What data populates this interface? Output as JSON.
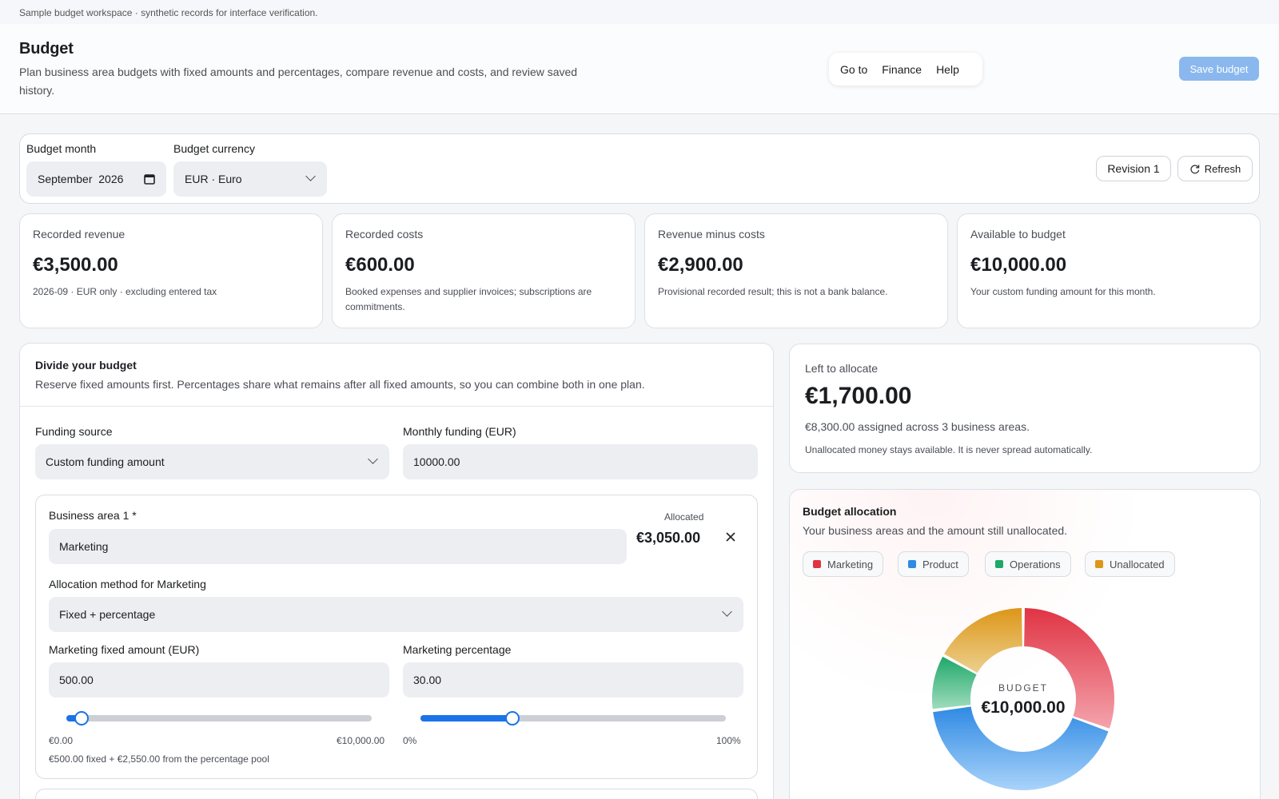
{
  "top_note": "Sample budget workspace · synthetic records for interface verification.",
  "header": {
    "title": "Budget",
    "subtitle": "Plan business area budgets with fixed amounts and percentages, compare revenue and costs, and review saved history.",
    "nav": [
      "Go to",
      "Finance",
      "Help"
    ],
    "save_label": "Save budget"
  },
  "filters": {
    "month_label": "Budget month",
    "month_value": "September  2026",
    "currency_label": "Budget currency",
    "currency_value": "EUR · Euro",
    "revision_label": "Revision 1",
    "refresh_label": "Refresh"
  },
  "stats": [
    {
      "label": "Recorded revenue",
      "value": "€3,500.00",
      "note": "2026-09 · EUR only · excluding entered tax"
    },
    {
      "label": "Recorded costs",
      "value": "€600.00",
      "note": "Booked expenses and supplier invoices; subscriptions are commitments."
    },
    {
      "label": "Revenue minus costs",
      "value": "€2,900.00",
      "note": "Provisional recorded result; this is not a bank balance."
    },
    {
      "label": "Available to budget",
      "value": "€10,000.00",
      "note": "Your custom funding amount for this month."
    }
  ],
  "divide": {
    "title": "Divide your budget",
    "description": "Reserve fixed amounts first. Percentages share what remains after all fixed amounts, so you can combine both in one plan.",
    "funding_source_label": "Funding source",
    "funding_source_value": "Custom funding amount",
    "monthly_funding_label": "Monthly funding (EUR)",
    "monthly_funding_value": "10000.00",
    "area": {
      "name_label": "Business area 1 *",
      "name_value": "Marketing",
      "allocated_label": "Allocated",
      "allocated_value": "€3,050.00",
      "method_label": "Allocation method for Marketing",
      "method_value": "Fixed + percentage",
      "fixed_label": "Marketing fixed amount (EUR)",
      "fixed_value": "500.00",
      "percent_label": "Marketing percentage",
      "percent_value": "30.00",
      "fixed_slider": {
        "fraction": 0.05,
        "min_label": "€0.00",
        "max_label": "€10,000.00"
      },
      "percent_slider": {
        "fraction": 0.3,
        "min_label": "0%",
        "max_label": "100%"
      },
      "breakdown": "€500.00 fixed + €2,550.00 from the percentage pool"
    }
  },
  "left_to_allocate": {
    "label": "Left to allocate",
    "value": "€1,700.00",
    "assigned": "€8,300.00 assigned across 3 business areas.",
    "note": "Unallocated money stays available. It is never spread automatically."
  },
  "allocation": {
    "title": "Budget allocation",
    "description": "Your business areas and the amount still unallocated.",
    "center_label": "BUDGET",
    "center_value": "€10,000.00",
    "legend": [
      {
        "name": "Marketing",
        "color": "#e03444"
      },
      {
        "name": "Product",
        "color": "#2f8ae3"
      },
      {
        "name": "Operations",
        "color": "#1fa86a"
      },
      {
        "name": "Unallocated",
        "color": "#dd9618"
      }
    ]
  },
  "chart_data": {
    "type": "pie",
    "categories": [
      "Marketing",
      "Product",
      "Operations",
      "Unallocated"
    ],
    "values": [
      3050,
      4250,
      1000,
      1700
    ],
    "colors": [
      "#e03444",
      "#2f8ae3",
      "#1fa86a",
      "#dd9618"
    ]
  }
}
